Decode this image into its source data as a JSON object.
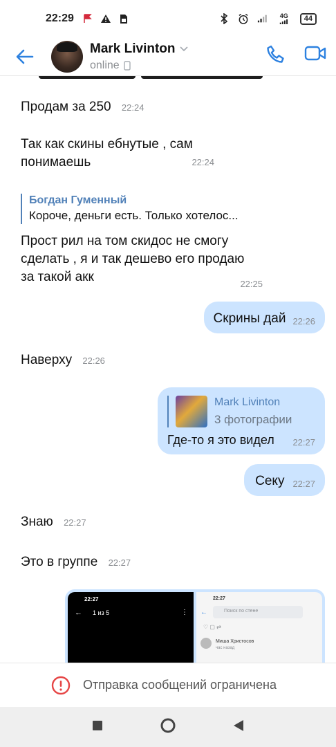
{
  "status_bar": {
    "time": "22:29",
    "network": "4G",
    "battery": "44"
  },
  "header": {
    "name": "Mark Livinton",
    "status": "online"
  },
  "messages": [
    {
      "dir": "in",
      "text": "Продам за 250",
      "time": "22:24"
    },
    {
      "dir": "in",
      "text_line1": "Так как скины ебнутые , сам",
      "text_line2": "понимаешь",
      "time": "22:24"
    },
    {
      "dir": "in",
      "reply_author": "Богдан Гуменный",
      "reply_text": "Короче, деньги есть. Только хотелос...",
      "text_line1": "Прост рил на том скидос не смогу",
      "text_line2": "сделать , я и так дешево его продаю",
      "text_line3": "за такой акк",
      "time": "22:25"
    },
    {
      "dir": "out",
      "text": "Скрины дай",
      "time": "22:26"
    },
    {
      "dir": "in",
      "text": "Наверху",
      "time": "22:26"
    },
    {
      "dir": "out",
      "quote_name": "Mark Livinton",
      "quote_sub": "3 фотографии",
      "text": "Где-то я это видел",
      "time": "22:27"
    },
    {
      "dir": "out",
      "text": "Секу",
      "time": "22:27"
    },
    {
      "dir": "in",
      "text": "Знаю",
      "time": "22:27"
    },
    {
      "dir": "in",
      "text": "Это в группе",
      "time": "22:27"
    }
  ],
  "attachment": {
    "left_time": "22:27",
    "left_counter": "1 из 5",
    "right_time": "22:27",
    "right_search": "Поиск по стене",
    "right_author": "Миша Христосов",
    "right_author_sub": "час назад"
  },
  "restriction": {
    "text": "Отправка сообщений ограничена",
    "color": "#e64646"
  },
  "colors": {
    "accent": "#5181b8",
    "out_bubble": "#cce4ff"
  }
}
